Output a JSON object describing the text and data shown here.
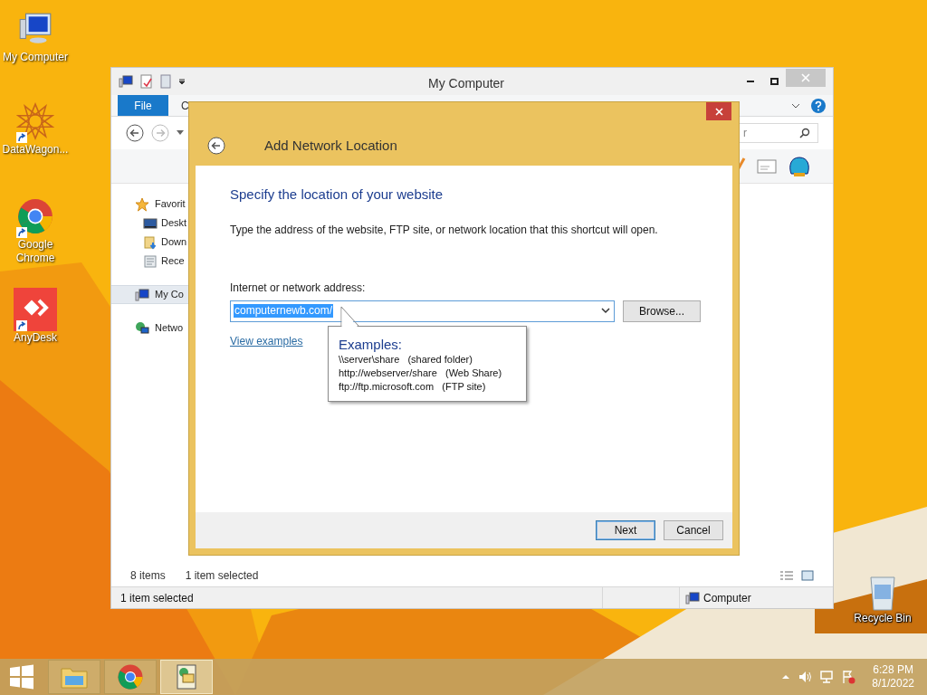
{
  "desktop": {
    "icons": [
      {
        "label": "My Computer",
        "kind": "computer",
        "shortcut": false
      },
      {
        "label": "DataWagon...",
        "kind": "star",
        "shortcut": true
      },
      {
        "label": "Google Chrome",
        "kind": "chrome",
        "shortcut": true
      },
      {
        "label": "AnyDesk",
        "kind": "anydesk",
        "shortcut": true
      }
    ],
    "recycle_bin": {
      "label": "Recycle Bin"
    }
  },
  "explorer": {
    "title": "My Computer",
    "ribbon_tabs": [
      {
        "label": "File",
        "selected": true
      },
      {
        "label": "C",
        "selected": false
      }
    ],
    "search": {
      "placeholder": "r"
    },
    "nav_items": [
      {
        "label": "Favorit",
        "kind": "star",
        "selected": false,
        "children": [
          {
            "label": "Deskt",
            "kind": "desktop",
            "selected": false
          },
          {
            "label": "Down",
            "kind": "download",
            "selected": false
          },
          {
            "label": "Rece",
            "kind": "recent",
            "selected": false
          }
        ]
      },
      {
        "label": "My Co",
        "kind": "computer",
        "selected": true
      },
      {
        "label": "Netwo",
        "kind": "network",
        "selected": false
      }
    ],
    "item_count": "8 items",
    "selection": "1 item selected",
    "status_bar": {
      "text": "1 item selected",
      "location": "Computer"
    }
  },
  "dialog": {
    "title": "Add Network Location",
    "heading": "Specify the location of your website",
    "description": "Type the address of the website, FTP site, or network location that this shortcut will open.",
    "address_label": "Internet or network address:",
    "address_value": "computernewb.com/",
    "browse": "Browse...",
    "link": "View examples",
    "tooltip": {
      "title": "Examples:",
      "lines": [
        "\\\\server\\share   (shared folder)",
        "http://webserver/share   (Web Share)",
        "ftp://ftp.microsoft.com   (FTP site)"
      ]
    },
    "buttons": [
      {
        "label": "Next",
        "kind": "primary"
      },
      {
        "label": "Cancel",
        "kind": "default"
      }
    ]
  },
  "taskbar": {
    "apps": [
      {
        "kind": "explorer",
        "selected": false
      },
      {
        "kind": "chrome",
        "selected": false
      },
      {
        "kind": "app",
        "selected": true
      }
    ],
    "time": "6:28 PM",
    "date": "8/1/2022"
  }
}
